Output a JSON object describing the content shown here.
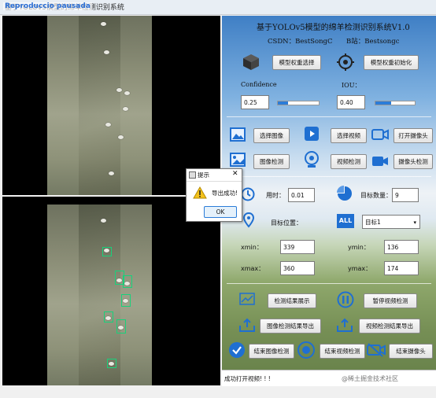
{
  "window": {
    "title": "基于YOLOv5模型的绵羊检测识别系统",
    "overlay_label": "Reproduccio pausada"
  },
  "header": {
    "title": "基于YOLOv5模型的绵羊检测识别系统V1.0",
    "subtitle_csdn": "CSDN：BestSongC",
    "subtitle_bili": "B站：Bestsongc"
  },
  "model": {
    "select_label": "模型权重选择",
    "init_label": "模型权重初始化"
  },
  "params": {
    "confidence_label": "Confidence",
    "confidence_value": "0.25",
    "confidence_level": 0.25,
    "iou_label": "IOU：",
    "iou_value": "0.40",
    "iou_level": 0.4
  },
  "actions": {
    "select_image": "选择图像",
    "select_video": "选择视频",
    "open_camera": "打开摄像头",
    "image_detect": "图像检测",
    "video_detect": "视频检测",
    "camera_detect": "摄像头检测"
  },
  "stats": {
    "time_label": "用时：",
    "time_value": "0.01",
    "count_label": "目标数量：",
    "count_value": "9",
    "position_label": "目标位置：",
    "target_select": "目标1"
  },
  "coords": {
    "xmin_label": "xmin：",
    "xmin_value": "339",
    "ymin_label": "ymin：",
    "ymin_value": "136",
    "xmax_label": "xmax：",
    "xmax_value": "360",
    "ymax_label": "ymax：",
    "ymax_value": "174"
  },
  "bottom": {
    "show_results": "检测结果展示",
    "pause_video": "暂停视频检测",
    "export_image": "图像检测结果导出",
    "export_video": "视频检测结果导出",
    "end_image": "结束图像检测",
    "end_video": "结束视频检测",
    "end_camera": "结束摄像头"
  },
  "dialog": {
    "title": "提示",
    "message": "导出成功!",
    "ok": "OK"
  },
  "status": {
    "text": "成功打开视频! ! !",
    "watermark": "@稀土掘金技术社区"
  }
}
